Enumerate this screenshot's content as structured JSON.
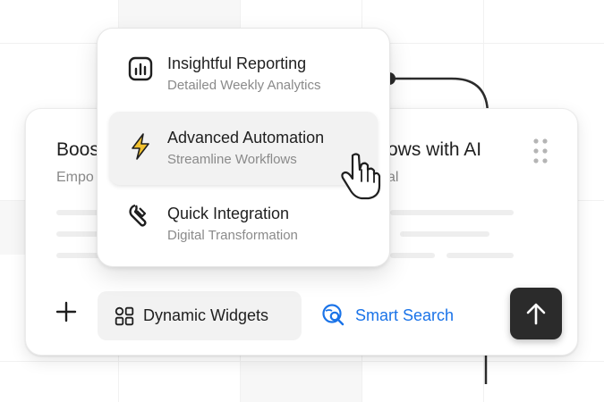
{
  "card": {
    "title_left": "Boos",
    "subtitle_left": "Empo",
    "title_right": "ows with AI",
    "subtitle_right": "al"
  },
  "menu": {
    "items": [
      {
        "icon": "bar-chart-icon",
        "title": "Insightful Reporting",
        "subtitle": "Detailed Weekly Analytics",
        "active": false
      },
      {
        "icon": "lightning-icon",
        "title": "Advanced Automation",
        "subtitle": "Streamline Workflows",
        "active": true
      },
      {
        "icon": "wrench-icon",
        "title": "Quick Integration",
        "subtitle": "Digital Transformation",
        "active": false
      }
    ]
  },
  "toolbar": {
    "add_icon": "plus-icon",
    "widgets_label": "Dynamic Widgets",
    "widgets_icon": "widgets-grid-icon",
    "search_label": "Smart Search",
    "search_icon": "smart-search-icon",
    "send_icon": "arrow-up-icon"
  },
  "colors": {
    "accent_blue": "#1a73e8",
    "lightning_yellow": "#f2c230",
    "send_button": "#2b2b2b"
  }
}
